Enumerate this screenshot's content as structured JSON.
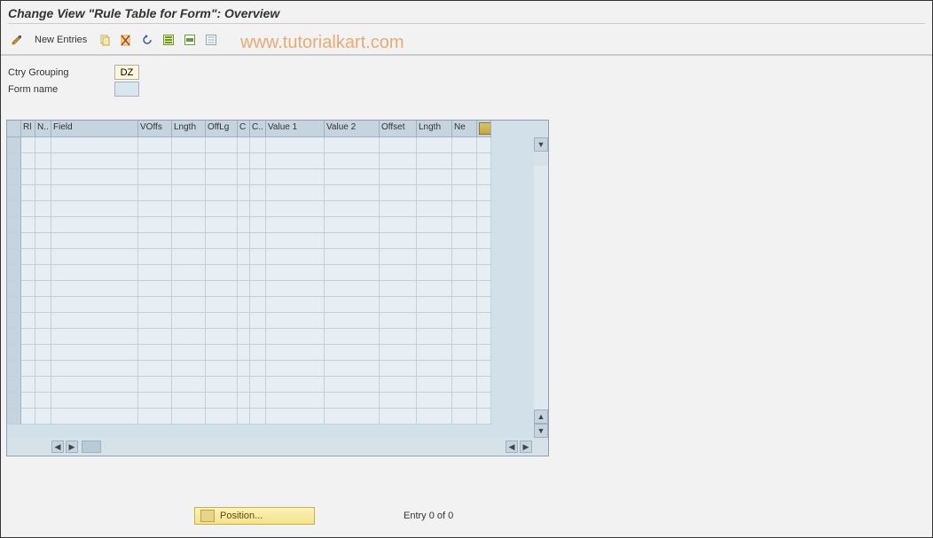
{
  "title": "Change View \"Rule Table for Form\": Overview",
  "watermark": "www.tutorialkart.com",
  "toolbar": {
    "new_entries": "New Entries",
    "icons": {
      "change": "change-icon",
      "copy": "copy-icon",
      "delete": "delete-icon",
      "undo": "undo-icon",
      "select_all": "select-all-icon",
      "deselect_all": "deselect-all-icon",
      "print": "print-icon"
    }
  },
  "form": {
    "ctry_grouping_label": "Ctry Grouping",
    "ctry_grouping_value": "DZ",
    "form_name_label": "Form name",
    "form_name_value": ""
  },
  "table": {
    "columns": [
      "",
      "Rl",
      "N..",
      "Field",
      "VOffs",
      "Lngth",
      "OffLg",
      "C",
      "C..",
      "Value 1",
      "Value 2",
      "Offset",
      "Lngth",
      "Ne",
      ""
    ],
    "rows_visible": 18
  },
  "footer": {
    "position_label": "Position...",
    "entry_text": "Entry 0 of 0"
  }
}
